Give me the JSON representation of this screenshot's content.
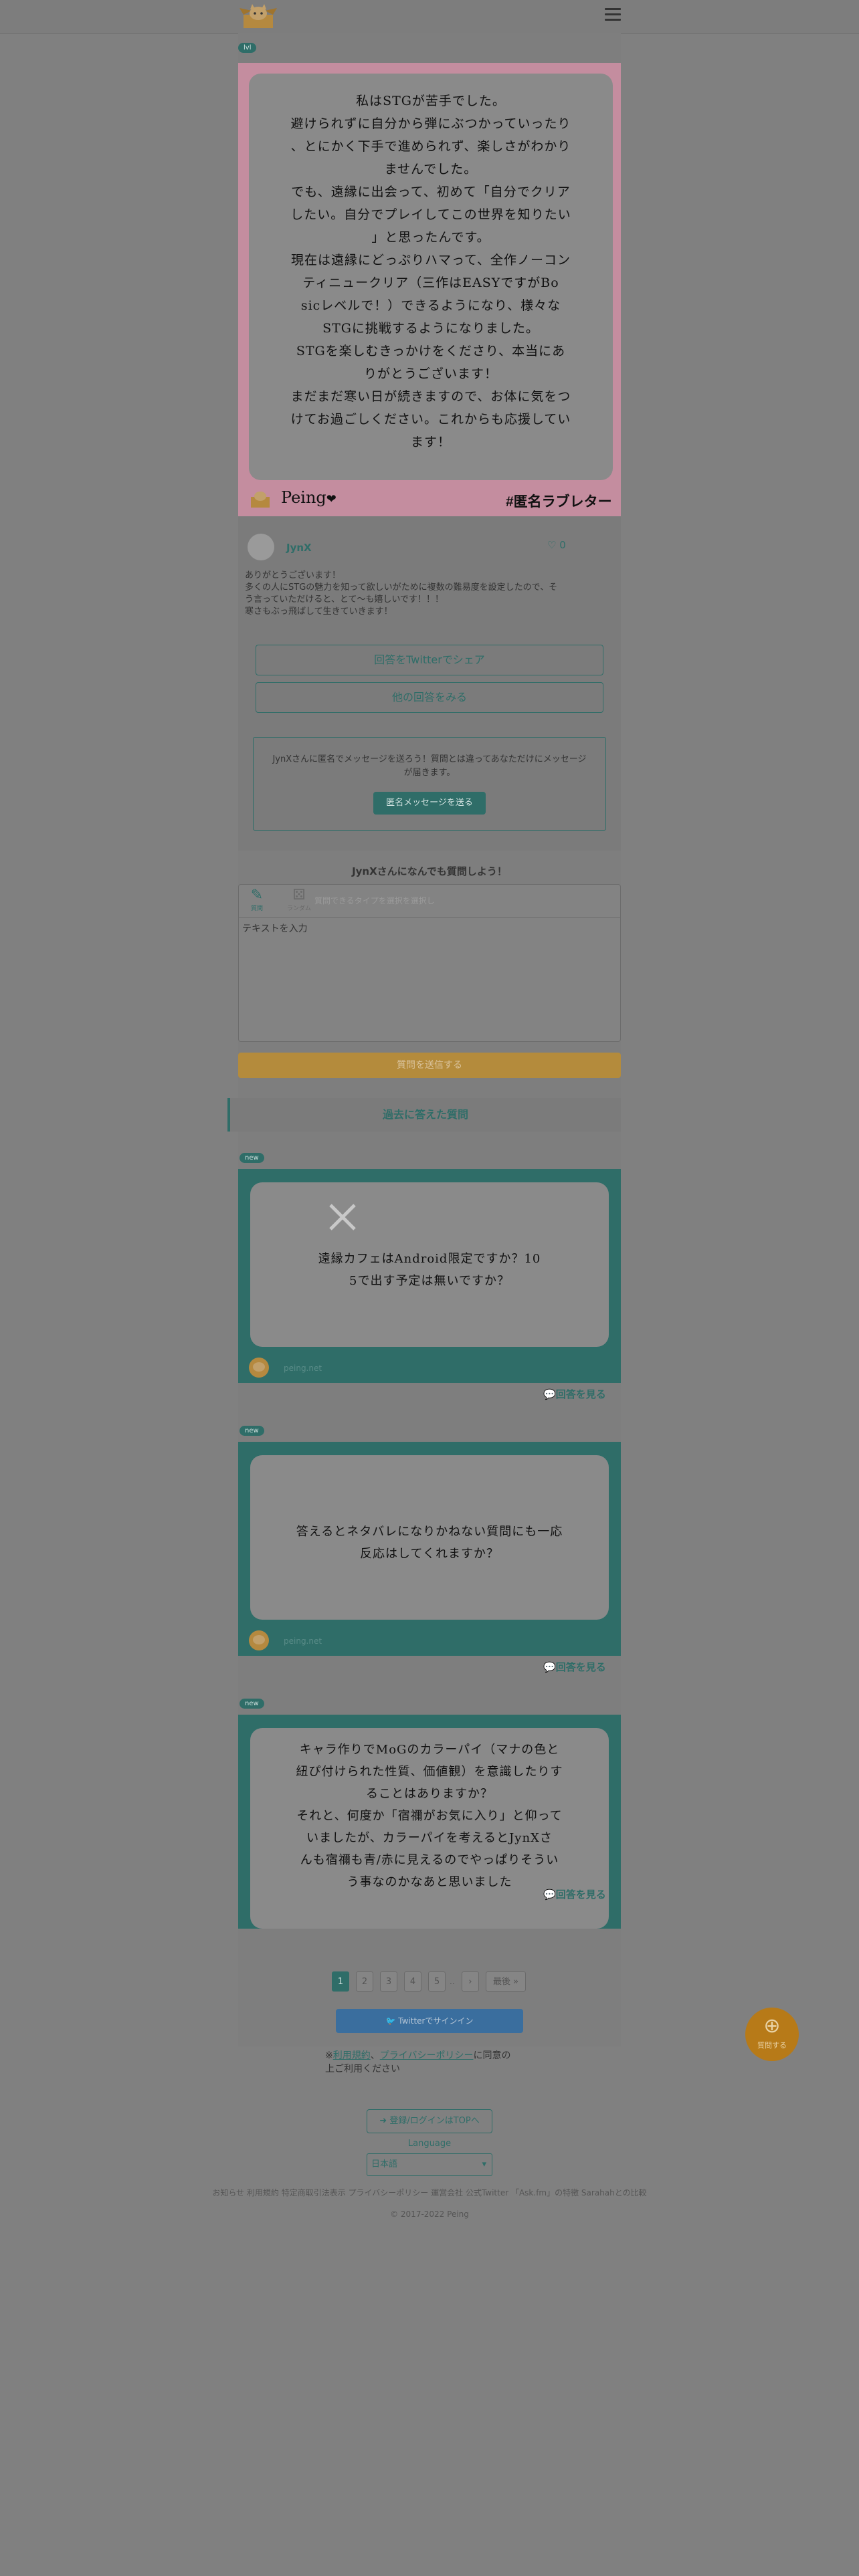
{
  "header": {
    "logo_icon": "cat-box-logo",
    "menu_icon": "hamburger-menu-icon"
  },
  "top_card": {
    "tag": "lvl",
    "lines": [
      "私はSTGが苦手でした。",
      "避けられずに自分から弾にぶつかっていったり",
      "、とにかく下手で進められず、楽しさがわかり",
      "ませんでした。",
      "でも、遠縁に出会って、初めて「自分でクリア",
      "したい。自分でプレイしてこの世界を知りたい",
      "」と思ったんです。",
      "現在は遠縁にどっぷりハマって、全作ノーコン",
      "ティニュークリア（三作はEASYですがBo",
      "sicレベルで！）できるようになり、様々な",
      "STGに挑戦するようになりました。",
      "STGを楽しむきっかけをくださり、本当にあ",
      "りがとうございます！",
      "まだまだ寒い日が続きますので、お体に気をつ",
      "けてお過ごしください。これからも応援してい",
      "ます！"
    ],
    "brand": "Peing",
    "heart": "❤",
    "hashtag": "#匿名ラブレター"
  },
  "answer": {
    "username": "JynX",
    "like_count": "0",
    "text": [
      "ありがとうございます！",
      "多くの人にSTGの魅力を知って欲しいがために複数の難易度を設定したので、そ",
      "う言っていただけると、とて〜も嬉しいです！！！",
      "寒さもぶっ飛ばして生きていきます！"
    ],
    "share_button": "回答をTwitterでシェア",
    "other_answers_button": "他の回答をみる",
    "message_text": "JynXさんに匿名でメッセージを送ろう！質問とは違ってあなただけにメッセージが届きます。",
    "message_button": "匿名メッセージを送る"
  },
  "ask": {
    "title": "JynXさんになんでも質問しよう！",
    "tab_question": "質問",
    "tab_random": "ランダム",
    "placeholder_top": "質問できるタイプを選択を選択し",
    "textarea_placeholder": "テキストを入力",
    "submit": "質問を送信する"
  },
  "past": {
    "title": "過去に答えた質問",
    "cards": [
      {
        "tag": "new",
        "lines": [
          "遠縁カフェはAndroid限定ですか？10",
          "5で出す予定は無いですか？"
        ],
        "footer": "peing.net",
        "see_answer": "回答を見る",
        "close_icon": "close-icon"
      },
      {
        "tag": "new",
        "lines": [
          "答えるとネタバレになりかねない質問にも一応",
          "反応はしてくれますか？"
        ],
        "footer": "peing.net",
        "see_answer": "回答を見る"
      },
      {
        "tag": "new",
        "lines": [
          "キャラ作りでMoGのカラーパイ（マナの色と",
          "紐ぴ付けられた性質、価値観）を意識したりす",
          "ることはありますか？",
          "それと、何度か「宿禰がお気に入り」と仰って",
          "いましたが、カラーパイを考えるとJynXさ",
          "んも宿禰も青/赤に見えるのでやっぱりそうい",
          "う事なのかなあと思いました"
        ],
        "see_answer": "回答を見る"
      }
    ]
  },
  "pagination": {
    "pages": [
      "1",
      "2",
      "3",
      "4",
      "5"
    ],
    "ellipsis": "..",
    "next": "›",
    "last": "最後 »"
  },
  "twitter_signin": "Twitterでサインイン",
  "terms": {
    "link1": "利用規約",
    "mid": "、",
    "link2": "プライバシーポリシー",
    "tail1": "に同意の",
    "tail2": "上ご利用ください",
    "prefix": "※"
  },
  "fab": {
    "label": "質問する"
  },
  "footer": {
    "login_button": "登録/ログインはTOPへ",
    "language_label": "Language",
    "language_value": "日本語",
    "nav": "お知らせ  利用規約  特定商取引法表示  プライバシーポリシー  運営会社  公式Twitter  「Ask.fm」の特徴  Sarahahとの比較",
    "copyright": "© 2017-2022 Peing"
  }
}
